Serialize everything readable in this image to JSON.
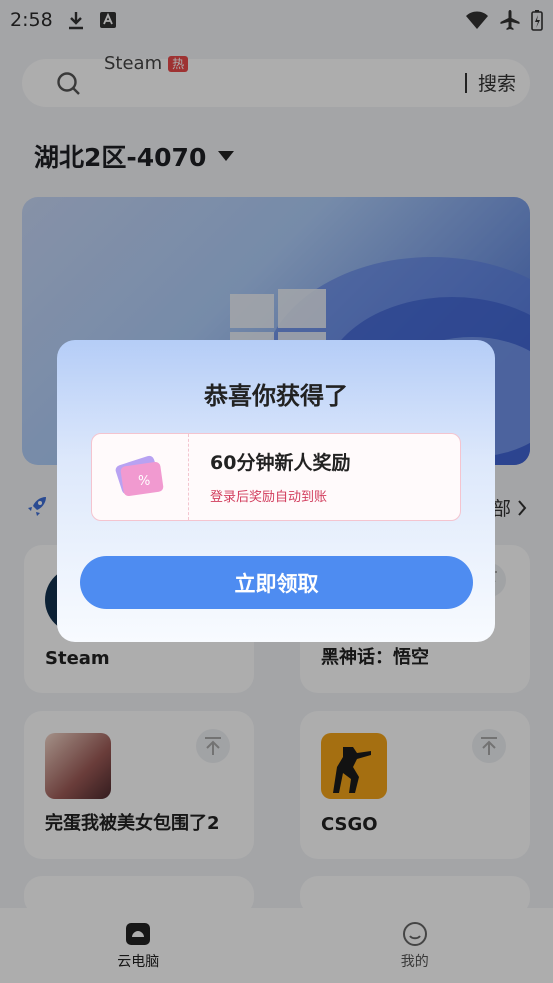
{
  "status": {
    "time": "2:58"
  },
  "search": {
    "hint": "Steam",
    "hot_badge": "热",
    "button": "搜索"
  },
  "region": {
    "label": "湖北2区-4070"
  },
  "row_more": {
    "label": "部"
  },
  "games": [
    {
      "name": "Steam"
    },
    {
      "name": "黑神话：悟空"
    },
    {
      "name": "完蛋我被美女包围了2"
    },
    {
      "name": "CSGO"
    }
  ],
  "tabs": [
    {
      "label": "云电脑"
    },
    {
      "label": "我的"
    }
  ],
  "modal": {
    "title": "恭喜你获得了",
    "coupon_title": "60分钟新人奖励",
    "coupon_subtitle": "登录后奖励自动到账",
    "claim_button": "立即领取"
  },
  "colors": {
    "accent": "#4e8cf1",
    "coupon_text": "#d23e5e",
    "hot": "#e94a4a"
  }
}
